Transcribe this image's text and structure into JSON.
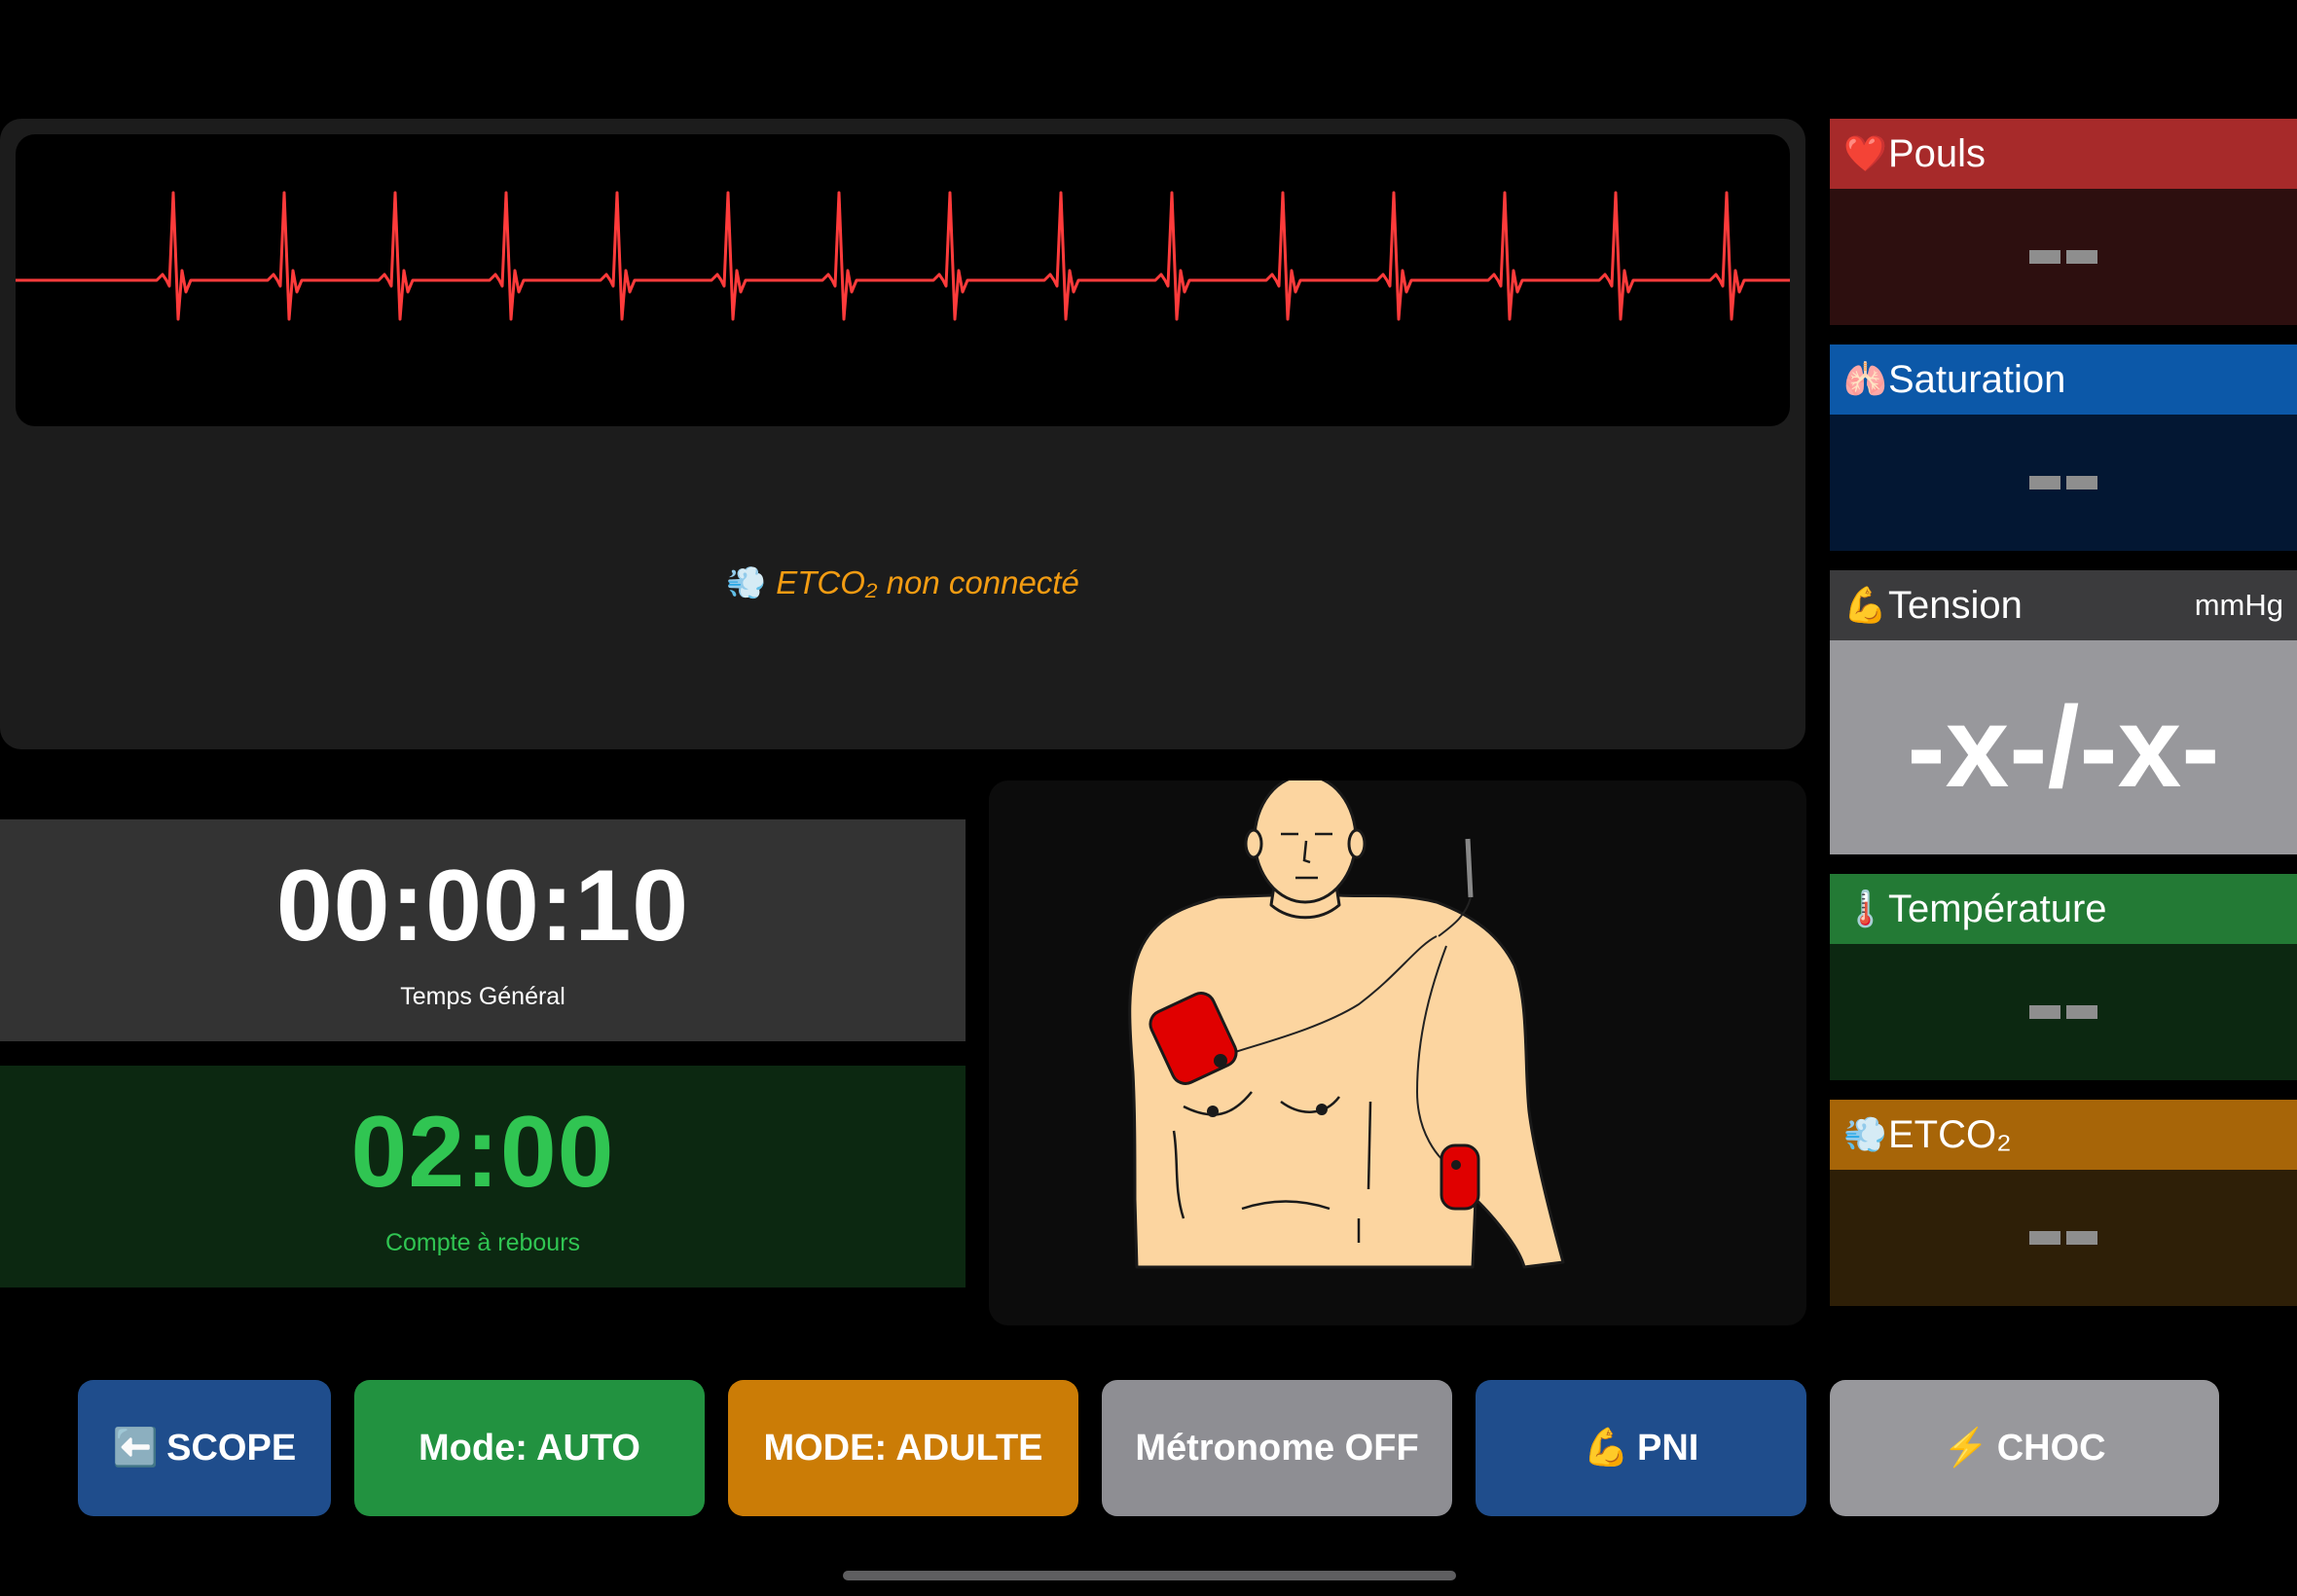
{
  "monitor": {
    "ecg_color": "#ff3b3b",
    "etco2_status_icon": "dash-wind-icon",
    "etco2_status_icon_glyph": "💨",
    "etco2_status_text": "ETCO₂ non connecté"
  },
  "timers": {
    "general": {
      "value": "00:00:10",
      "label": "Temps Général"
    },
    "countdown": {
      "value": "02:00",
      "label": "Compte à rebours"
    }
  },
  "vitals": {
    "pouls": {
      "icon": "heart-icon",
      "icon_glyph": "❤️",
      "label": "Pouls",
      "color": "#a72a2a"
    },
    "saturation": {
      "icon": "lungs-icon",
      "icon_glyph": "🫁",
      "label": "Saturation",
      "color": "#0c58a8"
    },
    "tension": {
      "icon": "flexed-biceps-icon",
      "icon_glyph": "💪",
      "label": "Tension",
      "unit": "mmHg",
      "value": "-x-/-x-"
    },
    "temperature": {
      "icon": "thermometer-icon",
      "icon_glyph": "🌡️",
      "label": "Température",
      "color": "#237a35"
    },
    "etco2": {
      "icon": "dash-wind-icon",
      "icon_glyph": "💨",
      "label": "ETCO₂",
      "color": "#a76508"
    }
  },
  "buttons": {
    "scope": {
      "icon": "left-arrow-icon",
      "icon_glyph": "⬅️",
      "label": "SCOPE"
    },
    "mode": {
      "label": "Mode: AUTO"
    },
    "adulte": {
      "label": "MODE: ADULTE"
    },
    "metronome": {
      "label": "Métronome OFF"
    },
    "pni": {
      "icon": "flexed-biceps-icon",
      "icon_glyph": "💪",
      "label": "PNI"
    },
    "choc": {
      "icon": "lightning-icon",
      "icon_glyph": "⚡",
      "label": "CHOC"
    }
  }
}
